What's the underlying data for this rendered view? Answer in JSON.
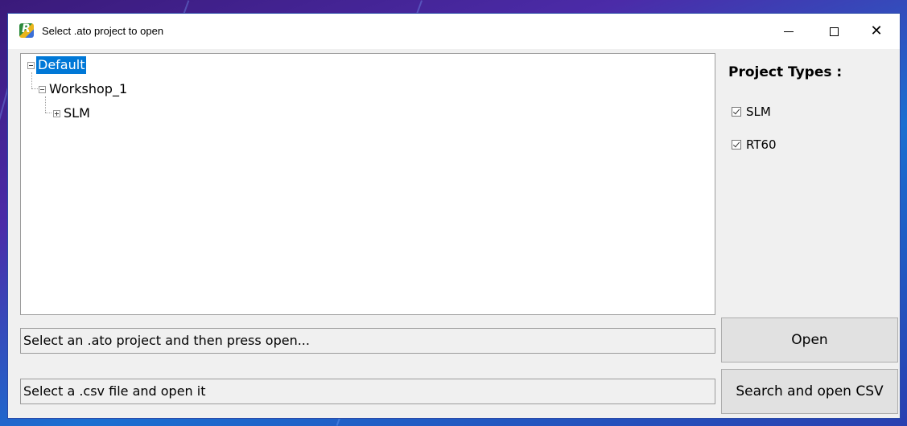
{
  "window": {
    "title": "Select .ato project to open",
    "icon": "app-logo-icon",
    "controls": [
      "minimize-icon",
      "maximize-icon",
      "close-icon"
    ]
  },
  "tree": {
    "items": [
      {
        "label": "Default",
        "level": 0,
        "expanded": true,
        "selected": true
      },
      {
        "label": "Workshop_1",
        "level": 1,
        "expanded": true,
        "selected": false
      },
      {
        "label": "SLM",
        "level": 2,
        "expanded": false,
        "selected": false
      }
    ]
  },
  "project_types": {
    "title": "Project Types :",
    "options": [
      {
        "label": "SLM",
        "checked": true
      },
      {
        "label": "RT60",
        "checked": true
      }
    ]
  },
  "ato_field": {
    "value": "Select an .ato project and then press open..."
  },
  "csv_field": {
    "value": "Select a .csv file and open it"
  },
  "buttons": {
    "open": "Open",
    "search_csv": "Search and open CSV"
  },
  "colors": {
    "selection": "#0078d7",
    "window_bg": "#f0f0f0"
  }
}
